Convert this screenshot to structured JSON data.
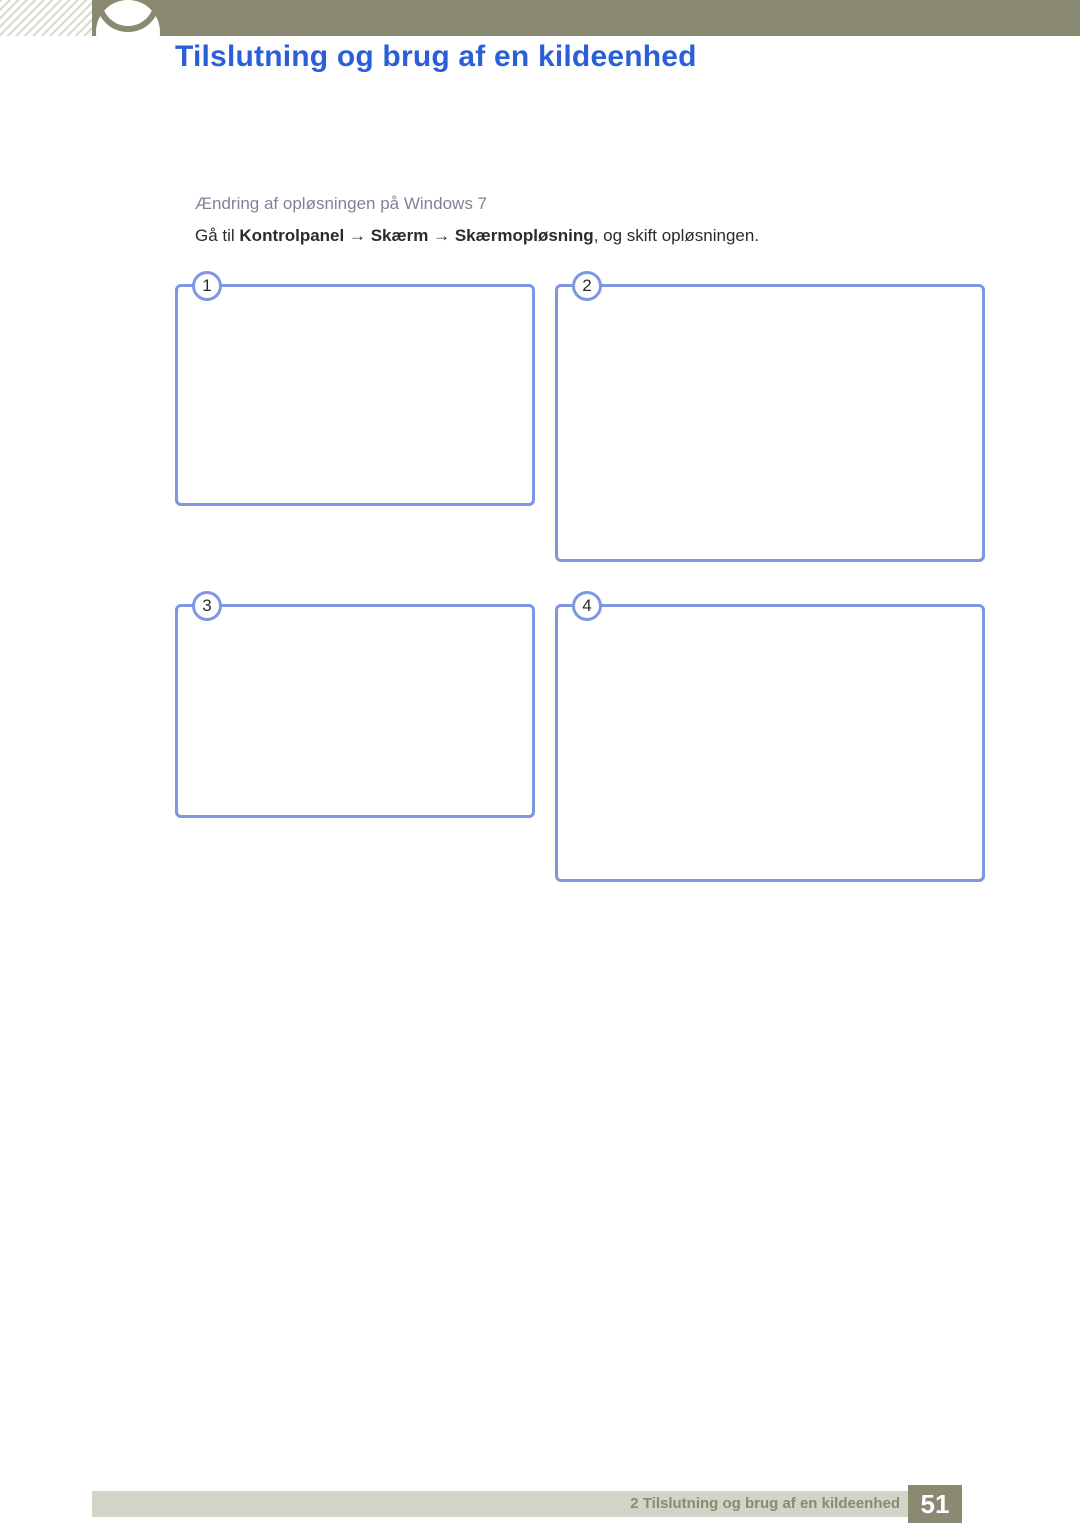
{
  "header": {
    "title": "Tilslutning og brug af en kildeenhed"
  },
  "section": {
    "subtitle": "Ændring af opløsningen på Windows 7",
    "instruction_prefix": "Gå til ",
    "crumb1": "Kontrolpanel",
    "crumb2": "Skærm",
    "crumb3": "Skærmopløsning",
    "instruction_suffix": ", og skift opløsningen."
  },
  "panels": {
    "p1": "1",
    "p2": "2",
    "p3": "3",
    "p4": "4"
  },
  "footer": {
    "chapter_label": "2 Tilslutning og brug af en kildeenhed",
    "page_number": "51"
  }
}
